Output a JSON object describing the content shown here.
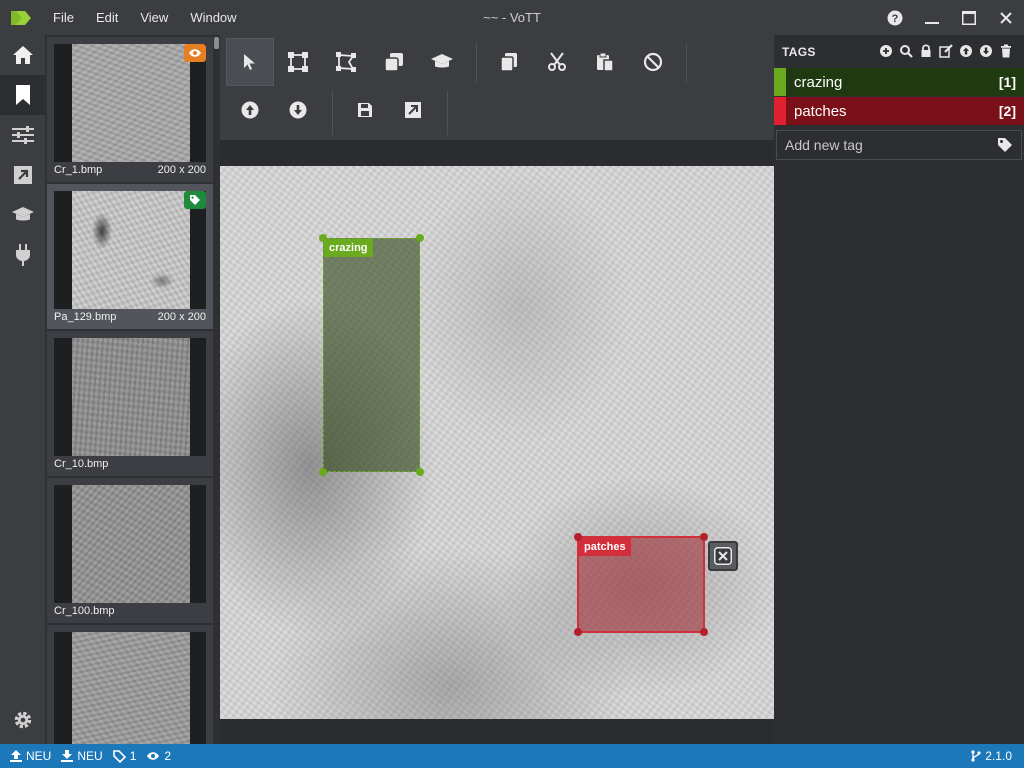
{
  "window": {
    "title": "~~ - VoTT",
    "menu": [
      "File",
      "Edit",
      "View",
      "Window"
    ]
  },
  "thumbnails": [
    {
      "name": "Cr_1.bmp",
      "dims": "200 x 200",
      "badge": "eye-icon",
      "badge_color": "#e67e22",
      "tone": "#a8a8a8"
    },
    {
      "name": "Pa_129.bmp",
      "dims": "200 x 200",
      "badge": "tag-icon",
      "badge_color": "#1e8a3c",
      "tone": "#c9c9c9"
    },
    {
      "name": "Cr_10.bmp",
      "dims": "",
      "badge": "",
      "badge_color": "",
      "tone": "#8c8c8c"
    },
    {
      "name": "Cr_100.bmp",
      "dims": "",
      "badge": "",
      "badge_color": "",
      "tone": "#929292"
    },
    {
      "name": "",
      "dims": "",
      "badge": "",
      "badge_color": "",
      "tone": "#9a9a9a"
    }
  ],
  "regions": [
    {
      "tag": "crazing",
      "color": "#6aaa1e"
    },
    {
      "tag": "patches",
      "color": "#d32f3a"
    }
  ],
  "tags_panel": {
    "header": "TAGS",
    "tags": [
      {
        "name": "crazing",
        "count": "[1]",
        "color": "#6aaa1e",
        "bg": "#1f3a10"
      },
      {
        "name": "patches",
        "count": "[2]",
        "color": "#e02030",
        "bg": "#7a1018"
      }
    ],
    "add_placeholder": "Add new tag"
  },
  "status": {
    "upload": "NEU",
    "download": "NEU",
    "tagged": "1",
    "visited": "2",
    "version": "2.1.0"
  },
  "colors": {
    "accent": "#1c78b8",
    "crazing": "#6aaa1e",
    "patches": "#d32f3a"
  }
}
